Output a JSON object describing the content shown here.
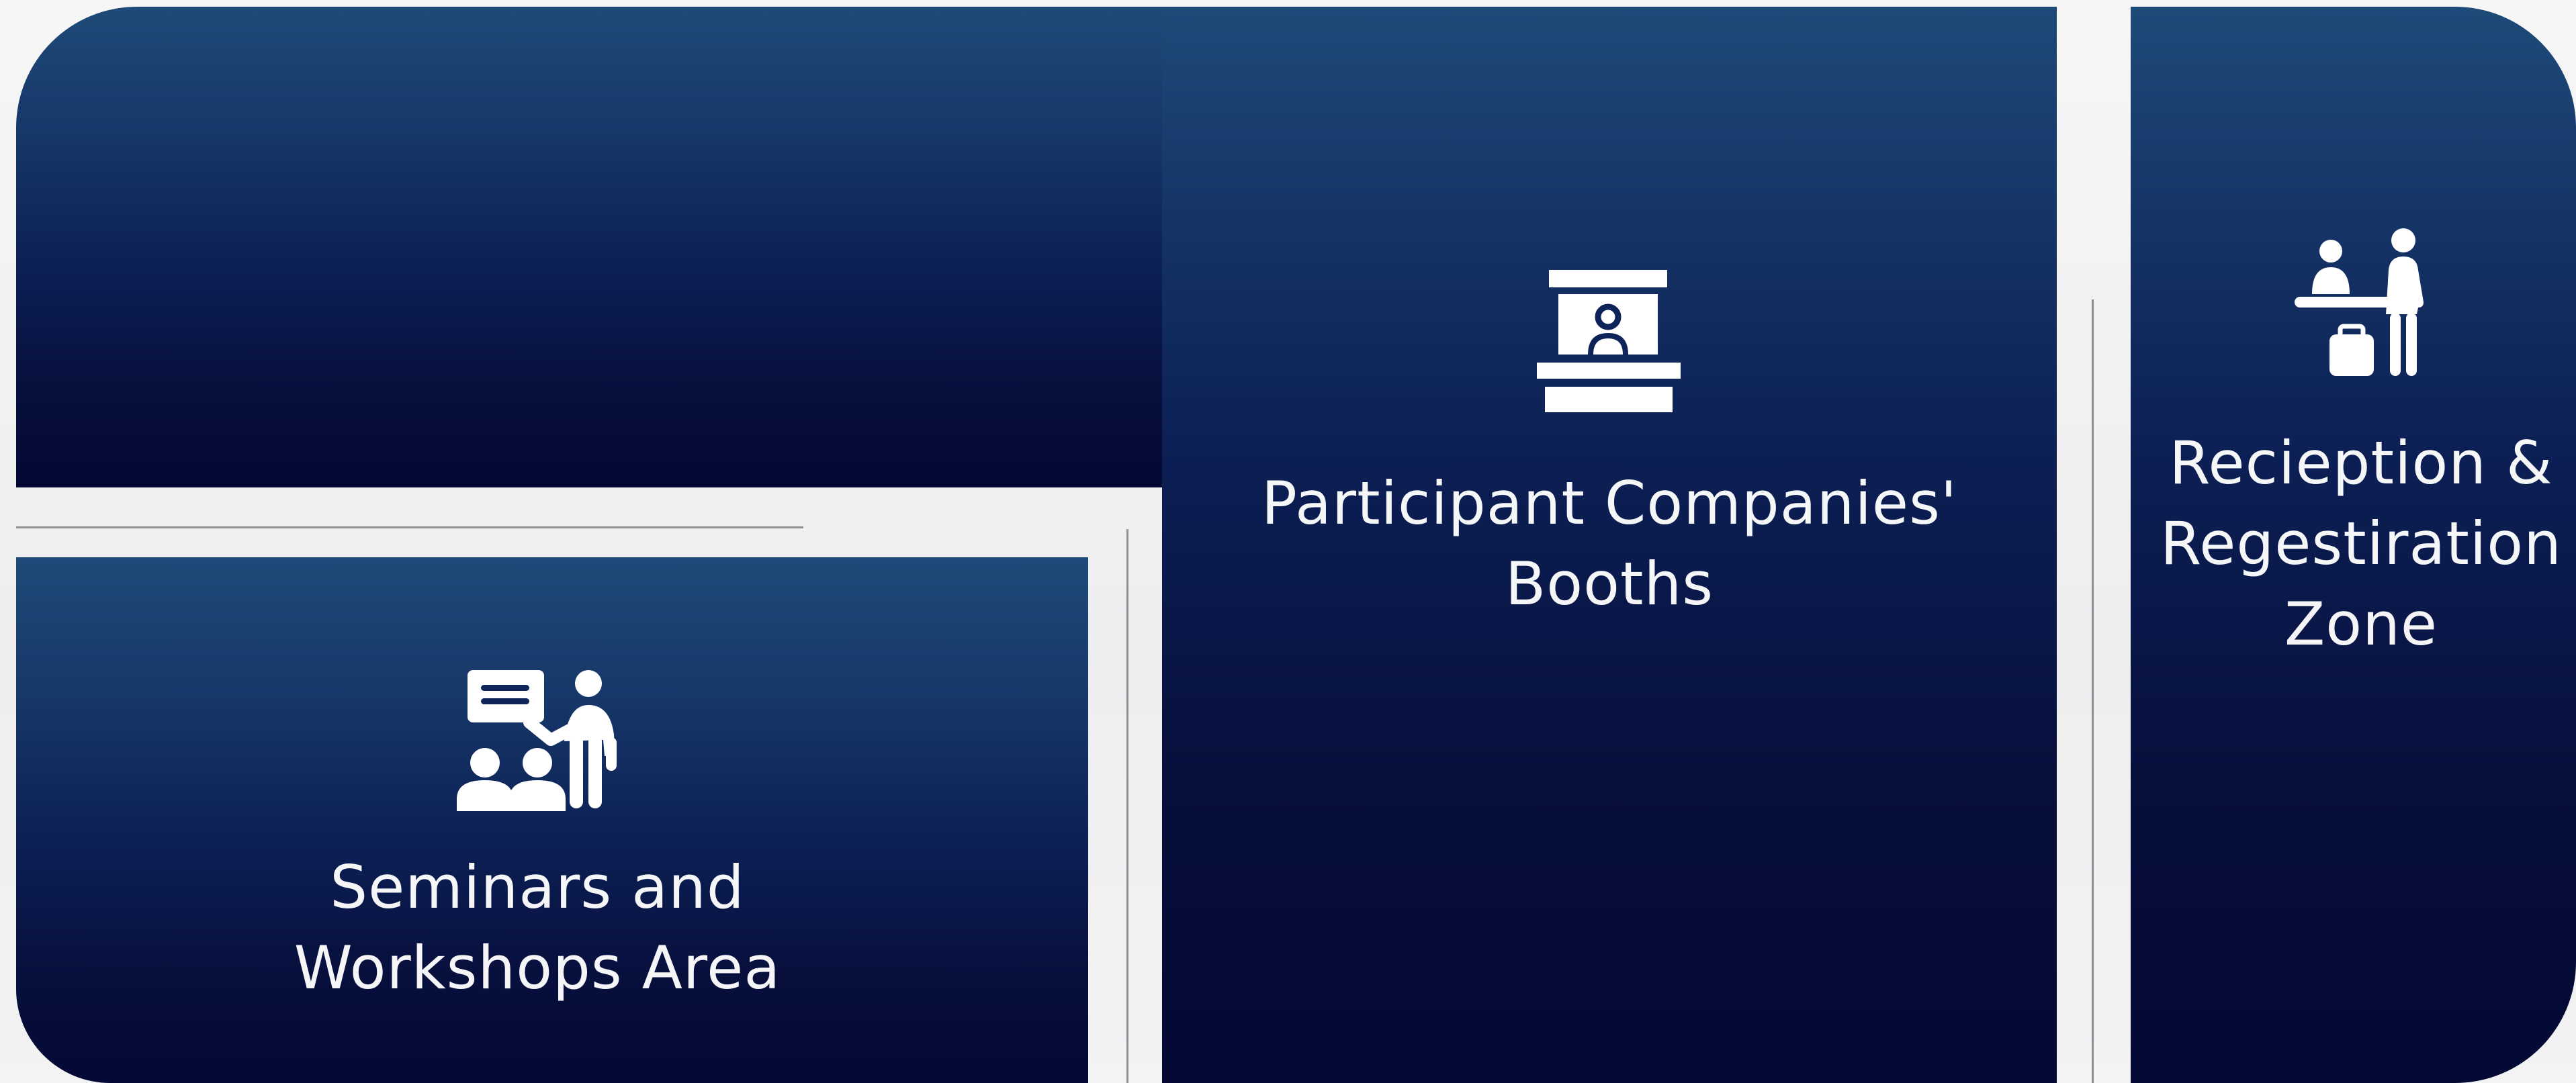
{
  "colors": {
    "zone_top": "#1d4a78",
    "zone_bottom": "#030934",
    "background": "#f1f1f2",
    "divider": "#8e8e93",
    "text": "#ffffff"
  },
  "zones": {
    "booths": {
      "label_line1": "Participant Companies'",
      "label_line2": "Booths",
      "icon": "booth-icon"
    },
    "reception": {
      "label_line1": "Recieption &",
      "label_line2": "Regestiration",
      "label_line3": "Zone",
      "icon": "reception-desk-icon"
    },
    "seminars": {
      "label_line1": "Seminars and",
      "label_line2": "Workshops Area",
      "icon": "presentation-icon"
    }
  }
}
